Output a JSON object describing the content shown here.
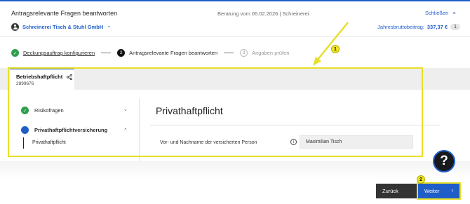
{
  "header": {
    "title": "Antragsrelevante Fragen beantworten",
    "center": "Beratung vom 06.02.2026 | Schreinerei",
    "close_label": "Schließen",
    "close_icon": "×",
    "company": "Schreinerei Tisch & Stuhl GmbH",
    "company_chevron": "⌄",
    "premium_label": "Jahresbruttobeitrag:",
    "premium_value": "337,37 €",
    "premium_count": "1"
  },
  "steps": [
    {
      "number": "✓",
      "label": "Deckungsauftrag konfigurieren",
      "state": "done"
    },
    {
      "number": "2",
      "label": "Antragsrelevante Fragen beantworten",
      "state": "active"
    },
    {
      "number": "3",
      "label": "Angaben prüfen",
      "state": "todo"
    }
  ],
  "tab": {
    "title": "Betriebshaftpflicht",
    "subtitle": "2899676",
    "share_icon": "share-icon"
  },
  "sidebar": {
    "items": [
      {
        "label": "Risikofragen",
        "status": "done",
        "chevron": "⌄"
      },
      {
        "label": "Privathaftpflichtversicherung",
        "status": "active",
        "chevron": "⌃"
      }
    ],
    "sub_item": "Privathaftpflicht"
  },
  "main": {
    "title": "Privathaftpflicht",
    "question_label": "Vor- und Nachname der versicherten Person",
    "info_icon": "i",
    "answer_value": "Maximilian Tisch"
  },
  "help_label": "?",
  "footer": {
    "back_label": "Zurück",
    "next_label": "Weiter",
    "next_arrow": "›"
  },
  "annotations": {
    "badge_1": "1",
    "badge_2": "2",
    "color": "#e8df2a"
  },
  "colors": {
    "accent": "#1f5ec8",
    "success": "#2f9e4f",
    "dark": "#333333"
  }
}
